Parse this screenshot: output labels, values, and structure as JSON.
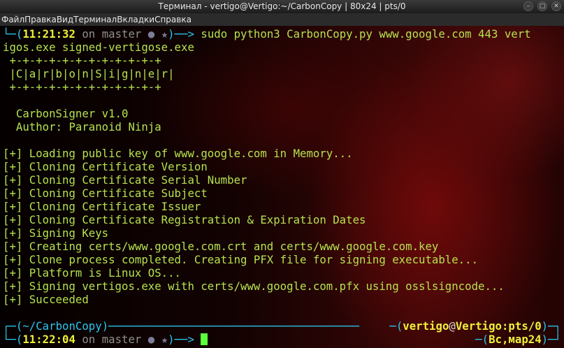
{
  "window": {
    "title": "Терминал - vertigo@Vertigo:~/CarbonCopy | 80x24 | pts/0",
    "buttons": [
      "–",
      "▢",
      "✕"
    ]
  },
  "menu": [
    "Файл",
    "Правка",
    "Вид",
    "Терминал",
    "Вкладки",
    "Справка"
  ],
  "prompt1": {
    "open": "└─(",
    "time": "11:21:32",
    "on": " on ",
    "branch": "master",
    "markers": " ● ★",
    "arrow": ")──> ",
    "command": "sudo python3 CarbonCopy.py www.google.com 443 vert",
    "command_cont": "igos.exe signed-vertigose.exe"
  },
  "banner": [
    " +-+-+-+-+-+-+-+-+-+-+-+",
    " |C|a|r|b|o|n|S|i|g|n|e|r|",
    " +-+-+-+-+-+-+-+-+-+-+-+"
  ],
  "info": [
    "  CarbonSigner v1.0",
    "  Author: Paranoid Ninja"
  ],
  "output": [
    "[+] Loading public key of www.google.com in Memory...",
    "[+] Cloning Certificate Version",
    "[+] Cloning Certificate Serial Number",
    "[+] Cloning Certificate Subject",
    "[+] Cloning Certificate Issuer",
    "[+] Cloning Certificate Registration & Expiration Dates",
    "[+] Signing Keys",
    "[+] Creating certs/www.google.com.crt and certs/www.google.com.key",
    "[+] Clone process completed. Creating PFX file for signing executable...",
    "[+] Platform is Linux OS...",
    "[+] Signing vertigos.exe with certs/www.google.com.pfx using osslsigncode...",
    "[+] Succeeded"
  ],
  "status": {
    "left_open": "┌─(",
    "dir": "~/CarbonCopy",
    "left_close": ")──────────────────────────────────────",
    "right_open": "─(",
    "user": "vertigo",
    "at": "@",
    "host": "Vertigo",
    "tty": ":pts/0",
    "right_close": ")─┐"
  },
  "prompt2": {
    "open": "└─(",
    "time": "11:22:04",
    "on": " on ",
    "branch": "master",
    "markers": " ● ★",
    "arrow": ")──> ",
    "date_open": "─(",
    "date": "Вс,мар24",
    "date_close": ")─┘"
  },
  "colors": {
    "bracket": "#29c8ee",
    "time": "#eef03a",
    "text": "#b6e24e",
    "cursor": "#5cff3c"
  }
}
